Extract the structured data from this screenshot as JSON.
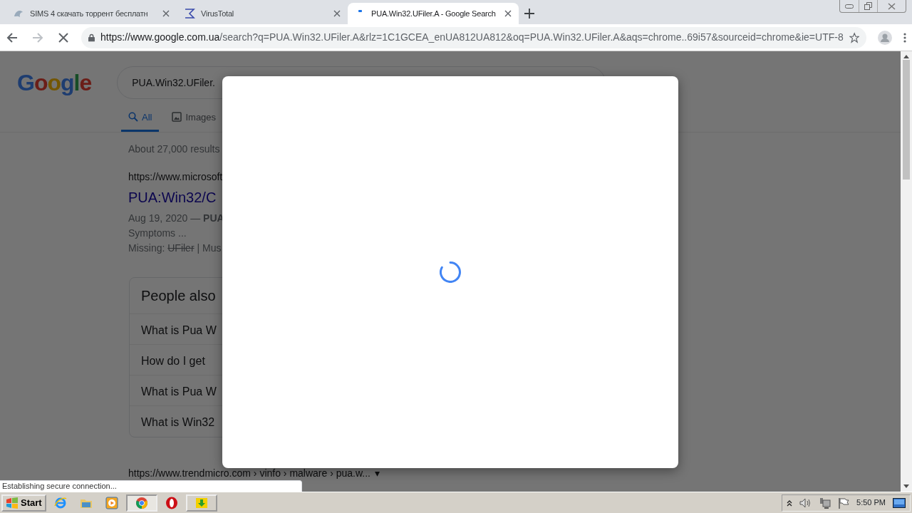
{
  "browser": {
    "tabs": [
      {
        "title": "SIMS 4 скачать торрент бесплатн",
        "selected": false
      },
      {
        "title": "VirusTotal",
        "selected": false
      },
      {
        "title": "PUA.Win32.UFiler.A - Google Search",
        "selected": true
      }
    ],
    "address": {
      "host": "https://www.google.com.ua",
      "path": "/search?q=PUA.Win32.UFiler.A&rlz=1C1GCEA_enUA812UA812&oq=PUA.Win32.UFiler.A&aqs=chrome..69i57&sourceid=chrome&ie=UTF-8",
      "loading": true
    }
  },
  "page": {
    "logo": "Google",
    "query": "PUA.Win32.UFiler.",
    "search_tabs": [
      {
        "label": "All",
        "selected": true
      },
      {
        "label": "Images",
        "selected": false
      }
    ],
    "result_count": "About 27,000 results",
    "result": {
      "url": "https://www.microsoft",
      "title": "PUA:Win32/C",
      "snippet": "Aug 19, 2020 — **PUA**",
      "snippet_2": "Symptoms ...",
      "missing_label": "Missing:",
      "missing_term": "UFiler",
      "missing_rest": "| Mus"
    },
    "people_also_ask": {
      "heading": "People also",
      "questions": [
        "What is Pua W",
        "How do I get",
        "What is Pua W",
        "What is Win32"
      ]
    },
    "next_result_url": "https://www.trendmicro.com › vinfo › malware › pua.w...",
    "next_result_menu": "▾",
    "dialog": {
      "loading": true
    }
  },
  "status_bubble": "Establishing secure connection...",
  "taskbar": {
    "start": "Start",
    "apps": [
      {
        "kind": "ie",
        "selected": false
      },
      {
        "kind": "folder",
        "selected": false
      },
      {
        "kind": "media",
        "selected": false
      },
      {
        "kind": "chrome",
        "selected": true
      },
      {
        "kind": "opera",
        "selected": false
      },
      {
        "kind": "download",
        "selected": false
      }
    ],
    "clock": "5:50 PM"
  }
}
